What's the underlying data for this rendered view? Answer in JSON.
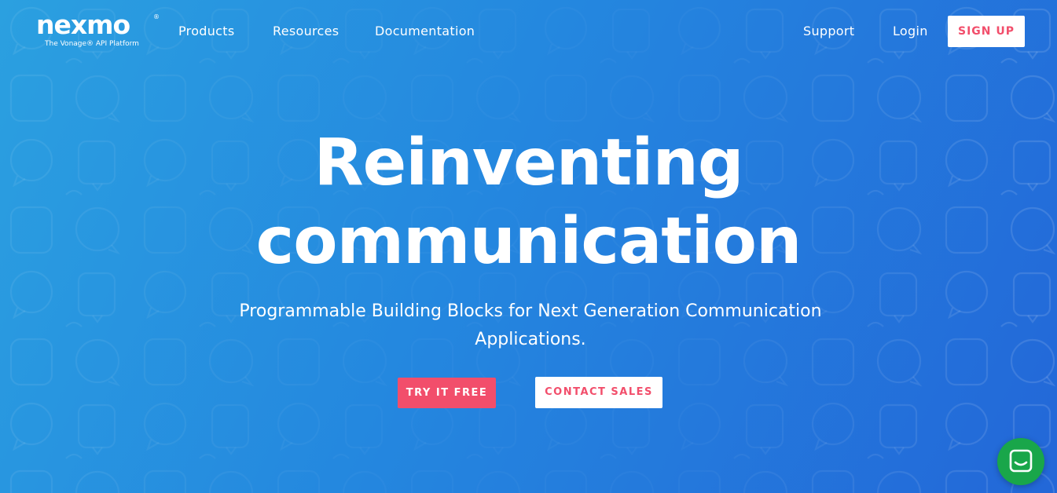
{
  "brand": {
    "logo_text": "nexmo",
    "registered_mark": "®",
    "tagline": "The Vonage® API Platform"
  },
  "nav": {
    "left": [
      "Products",
      "Resources",
      "Documentation"
    ],
    "right": [
      "Support",
      "Login"
    ],
    "signup_label": "SIGN UP"
  },
  "hero": {
    "title_line1": "Reinventing",
    "title_line2": "communication",
    "subtitle": "Programmable Building Blocks for Next Generation Communication Applications.",
    "primary_cta": "TRY IT FREE",
    "secondary_cta": "CONTACT SALES"
  },
  "colors": {
    "gradient_start": "#2ba0e0",
    "gradient_end": "#2367d8",
    "accent": "#f24e6b",
    "chat_launcher": "#19a64a"
  },
  "icons": {
    "background_pattern": "chat-bubble-pattern",
    "chat_launcher": "chat-icon"
  }
}
